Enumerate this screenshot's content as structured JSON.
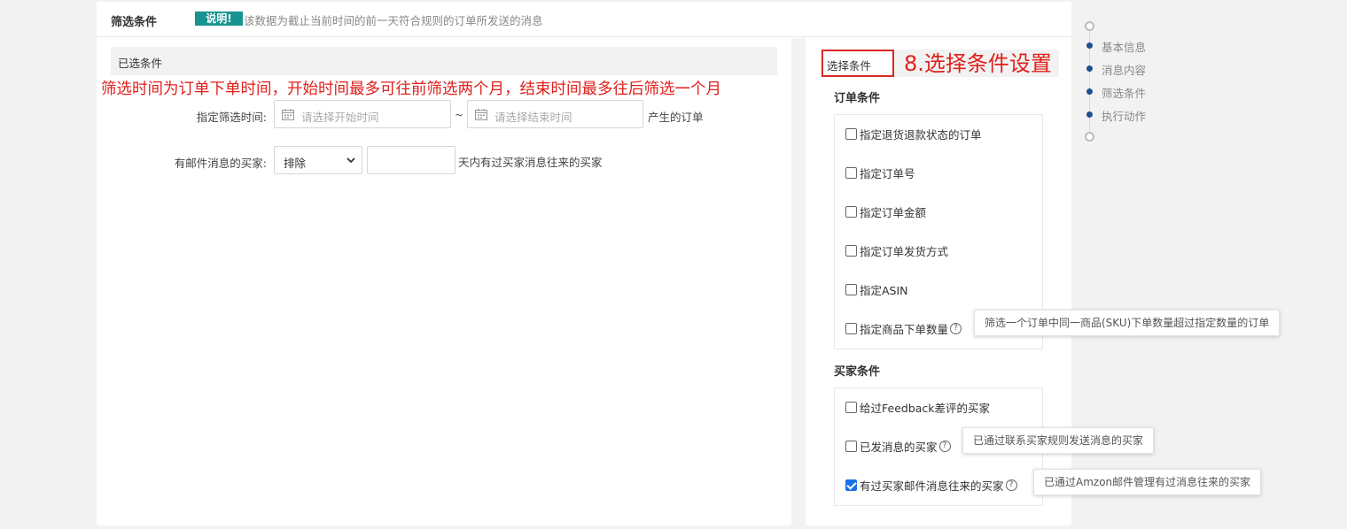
{
  "header": {
    "title": "筛选条件",
    "badge": "说明!",
    "description": "该数据为截止当前时间的前一天符合规则的订单所发送的消息"
  },
  "left": {
    "selected_title": "已选条件",
    "red_note": "筛选时间为订单下单时间，开始时间最多可往前筛选两个月，结束时间最多往后筛选一个月",
    "date_row": {
      "label": "指定筛选时间:",
      "start_placeholder": "请选择开始时间",
      "separator": "~",
      "end_placeholder": "请选择结束时间",
      "suffix": "产生的订单"
    },
    "mail_row": {
      "label": "有邮件消息的买家:",
      "select_value": "排除",
      "days_value": "",
      "suffix": "天内有过买家消息往来的买家"
    }
  },
  "right": {
    "choose_title": "选择条件",
    "red_title": "8.选择条件设置",
    "order_section": {
      "title": "订单条件",
      "items": [
        {
          "label": "指定退货退款状态的订单",
          "checked": false,
          "help": false
        },
        {
          "label": "指定订单号",
          "checked": false,
          "help": false
        },
        {
          "label": "指定订单金额",
          "checked": false,
          "help": false
        },
        {
          "label": "指定订单发货方式",
          "checked": false,
          "help": false
        },
        {
          "label": "指定ASIN",
          "checked": false,
          "help": false
        },
        {
          "label": "指定商品下单数量",
          "checked": false,
          "help": true,
          "tooltip": "筛选一个订单中同一商品(SKU)下单数量超过指定数量的订单"
        }
      ]
    },
    "buyer_section": {
      "title": "买家条件",
      "items": [
        {
          "label": "给过Feedback差评的买家",
          "checked": false,
          "help": false
        },
        {
          "label": "已发消息的买家",
          "checked": false,
          "help": true,
          "tooltip": "已通过联系买家规则发送消息的买家"
        },
        {
          "label": "有过买家邮件消息往来的买家",
          "checked": true,
          "help": true,
          "tooltip": "已通过Amzon邮件管理有过消息往来的买家"
        }
      ]
    }
  },
  "steps": [
    {
      "label": "基本信息"
    },
    {
      "label": "消息内容"
    },
    {
      "label": "筛选条件"
    },
    {
      "label": "执行动作"
    }
  ],
  "colors": {
    "badge_bg": "#17948f",
    "annotation_red": "#e0201c",
    "step_dot": "#1d4f91",
    "checkbox_checked": "#1a73e8"
  },
  "icons": [
    "calendar-icon",
    "chevron-down-icon",
    "question-icon",
    "checkbox-icon"
  ]
}
